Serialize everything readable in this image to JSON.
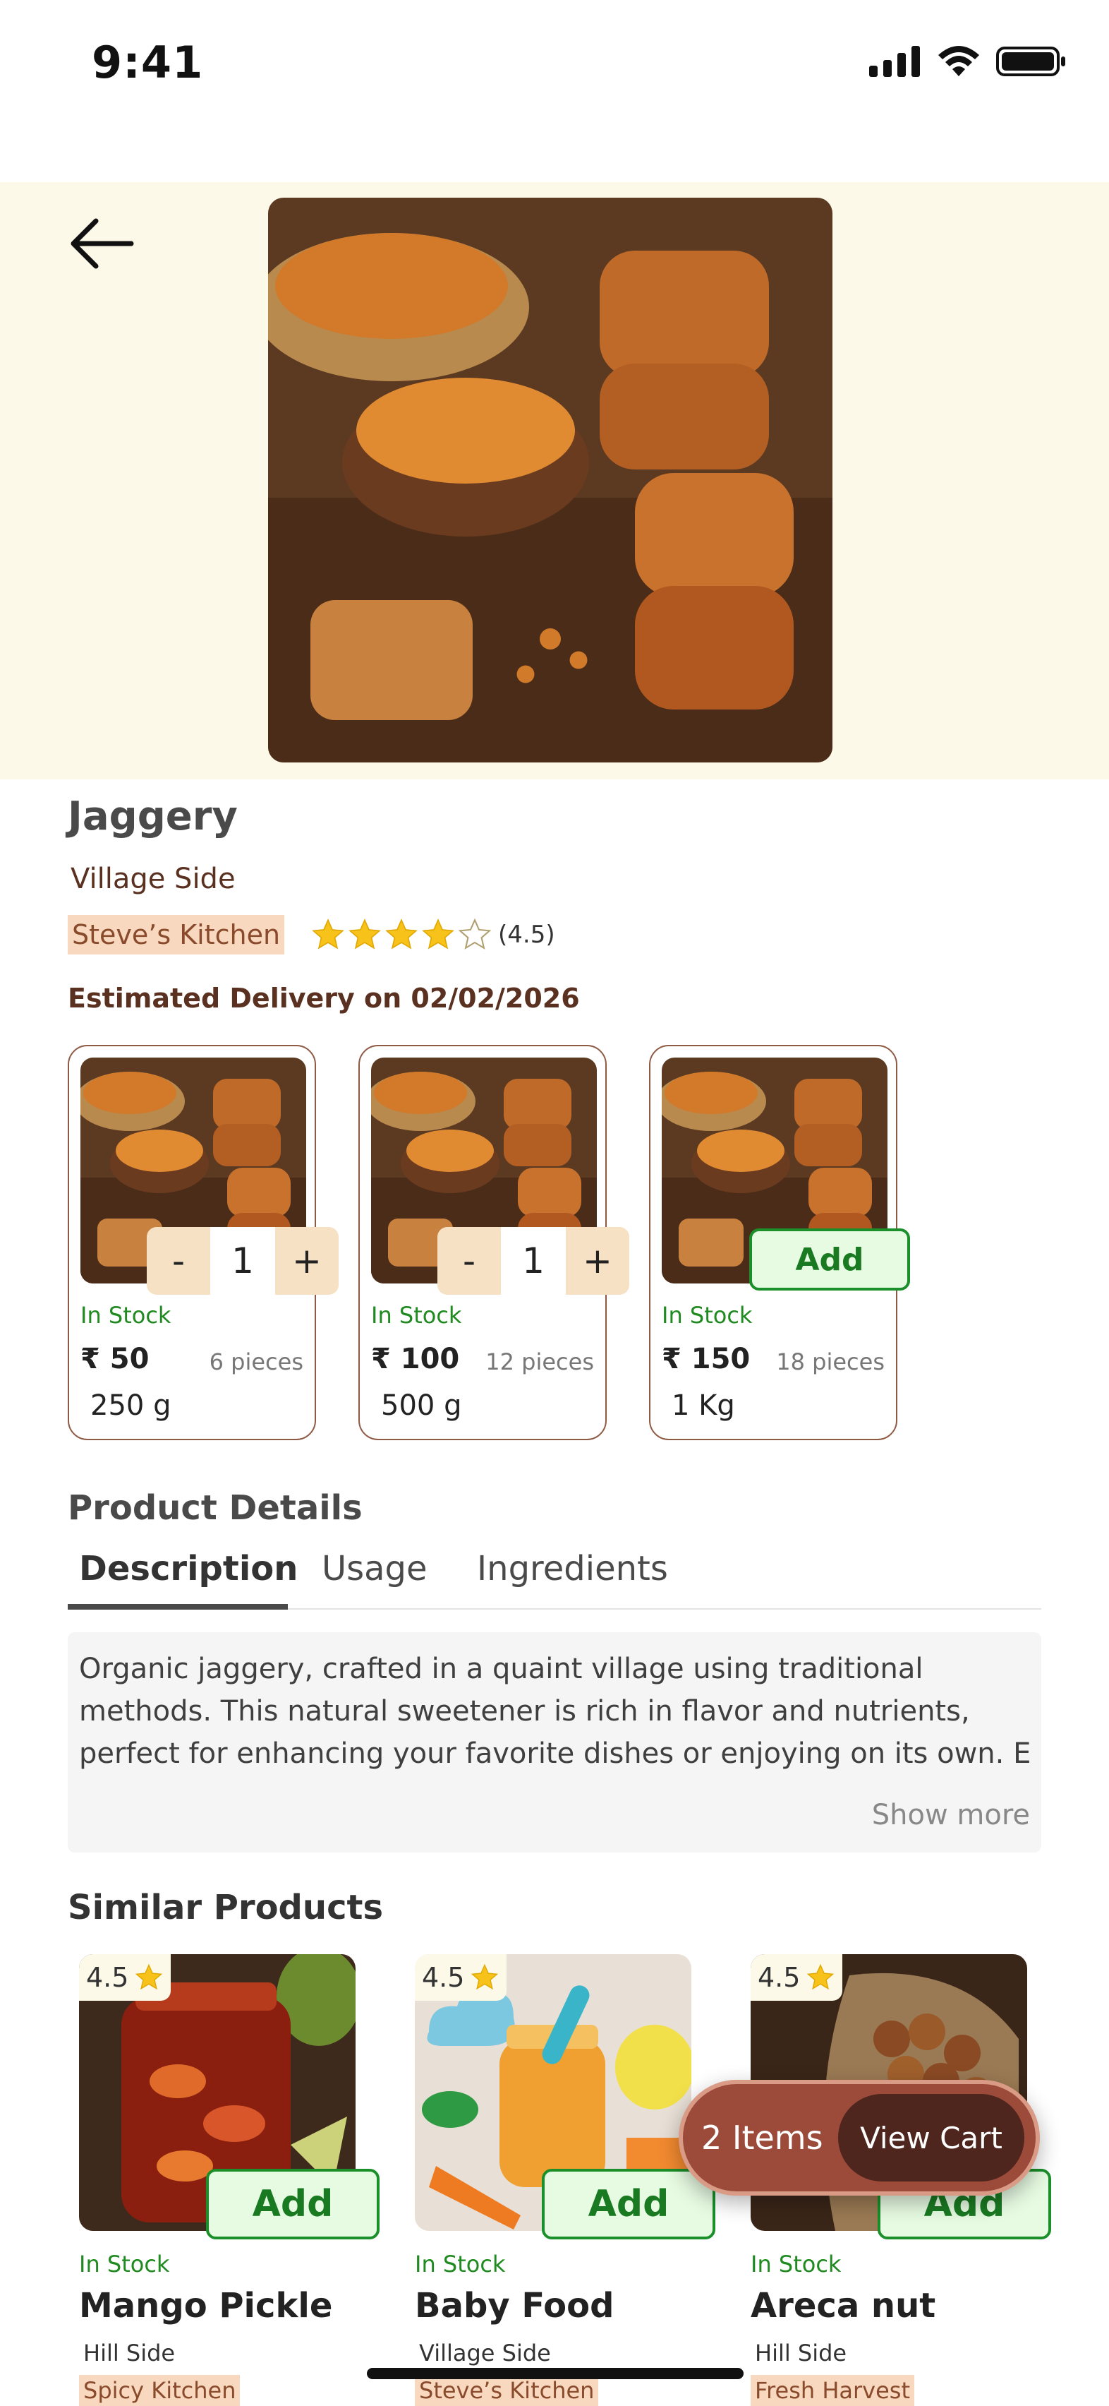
{
  "status_bar": {
    "time": "9:41"
  },
  "product": {
    "title": "Jaggery",
    "origin": "Village Side",
    "seller": "Steve’s Kitchen",
    "rating": 4.5,
    "rating_text": "(4.5)",
    "delivery": "Estimated Delivery on 02/02/2026",
    "variants": [
      {
        "stock": "In Stock",
        "price": "₹ 50",
        "pieces": "6 pieces",
        "weight": "250 g",
        "quantity": "1",
        "minus": "-",
        "plus": "+"
      },
      {
        "stock": "In Stock",
        "price": "₹ 100",
        "pieces": "12 pieces",
        "weight": "500 g",
        "quantity": "1",
        "minus": "-",
        "plus": "+"
      },
      {
        "stock": "In Stock",
        "price": "₹ 150",
        "pieces": "18 pieces",
        "weight": "1 Kg",
        "add_label": "Add"
      }
    ]
  },
  "details": {
    "heading": "Product Details",
    "tabs": [
      "Description",
      "Usage",
      "Ingredients"
    ],
    "active_tab": "Description",
    "description_lines": [
      "Organic jaggery, crafted in a quaint village using traditional",
      "methods. This natural sweetener is rich in flavor and nutrients,",
      "perfect for enhancing your favorite dishes or enjoying on its own. E..."
    ],
    "show_more": "Show more"
  },
  "similar": {
    "heading": "Similar Products",
    "items": [
      {
        "rating": "4.5",
        "add_label": "Add",
        "stock": "In Stock",
        "name": "Mango Pickle",
        "origin": "Hill Side",
        "seller": "Spicy Kitchen"
      },
      {
        "rating": "4.5",
        "add_label": "Add",
        "stock": "In Stock",
        "name": "Baby Food",
        "origin": "Village Side",
        "seller": "Steve’s Kitchen"
      },
      {
        "rating": "4.5",
        "add_label": "Add",
        "stock": "In Stock",
        "name": "Areca nut",
        "origin": "Hill Side",
        "seller": "Fresh Harvest"
      }
    ]
  },
  "cart": {
    "count": "2 Items",
    "button": "View Cart"
  },
  "colors": {
    "hero_bg": "#fdf9e8",
    "brand_brown": "#9c4a3a",
    "dark_brown": "#4e261d",
    "add_green": "#1a8f2a",
    "stock_green": "#1f8a1f",
    "seller_tag": "#f8d9bf",
    "star": "#f7c21a"
  },
  "icons": [
    "signal-icon",
    "wifi-icon",
    "battery-icon",
    "back-arrow-icon",
    "star-icon"
  ]
}
